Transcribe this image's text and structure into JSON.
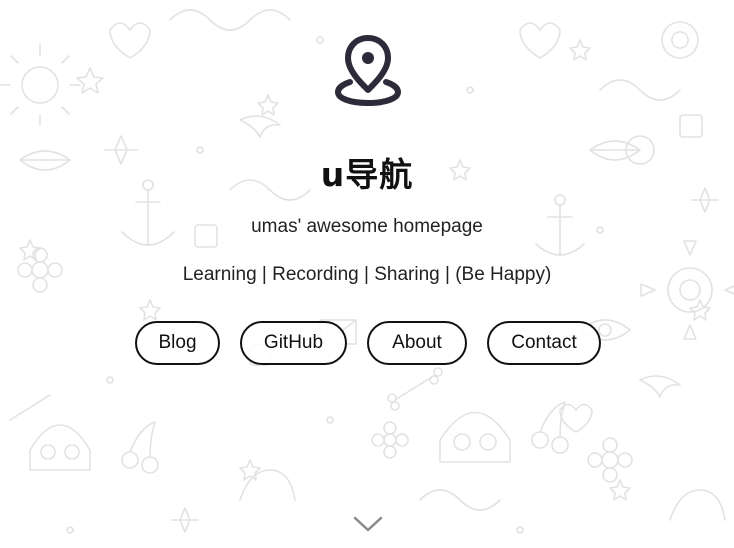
{
  "site": {
    "title": "u导航",
    "subtitle": "umas' awesome homepage",
    "tagline": "Learning | Recording | Sharing | (Be Happy)"
  },
  "nav": {
    "items": [
      {
        "label": "Blog"
      },
      {
        "label": "GitHub"
      },
      {
        "label": "About"
      },
      {
        "label": "Contact"
      }
    ]
  },
  "icons": {
    "logo": "map-pin-icon",
    "scroll": "chevron-down-icon",
    "background": "doodle-pattern"
  },
  "colors": {
    "text": "#111111",
    "background": "#ffffff",
    "doodle": "#e4e4e6",
    "icon": "#2b2b3a",
    "chevron": "#8a8a8a"
  }
}
